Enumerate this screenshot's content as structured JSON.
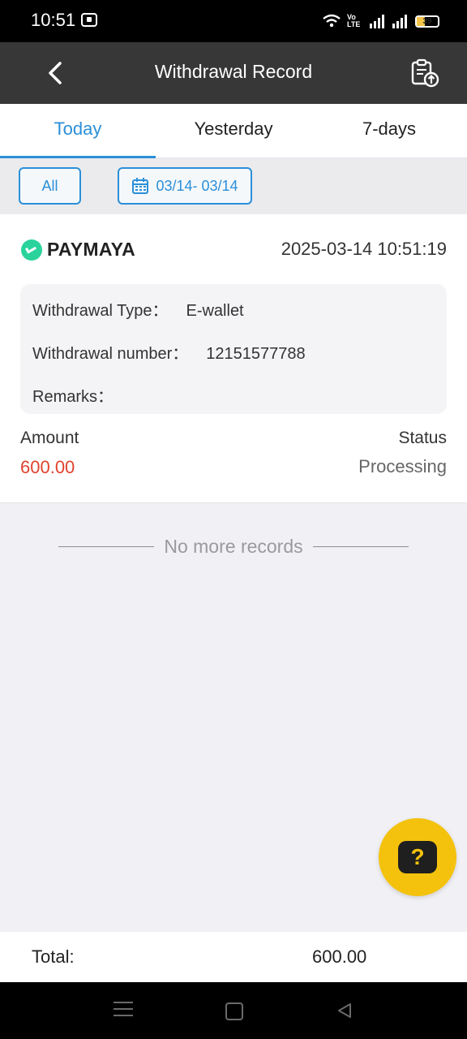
{
  "status_bar": {
    "time": "10:51",
    "network_label": "Vo LTE",
    "battery": "39"
  },
  "header": {
    "title": "Withdrawal Record"
  },
  "tabs": [
    {
      "label": "Today",
      "active": true
    },
    {
      "label": "Yesterday",
      "active": false
    },
    {
      "label": "7-days",
      "active": false
    }
  ],
  "filters": {
    "type_label": "All",
    "date_range": "03/14- 03/14"
  },
  "record": {
    "brand": "PAYMAYA",
    "datetime": "2025-03-14 10:51:19",
    "withdrawal_type_label": "Withdrawal Type：",
    "withdrawal_type_value": "E-wallet",
    "withdrawal_number_label": "Withdrawal number：",
    "withdrawal_number_value": "12151577788",
    "remarks_label": "Remarks：",
    "remarks_value": "",
    "amount_label": "Amount",
    "amount_value": "600.00",
    "status_label": "Status",
    "status_value": "Processing"
  },
  "list_footer": "No more records",
  "help_button": "?",
  "totals": {
    "label": "Total:",
    "value": "600.00"
  },
  "colors": {
    "accent": "#2b8fd8",
    "amount": "#e0432e",
    "header_bg": "#373737",
    "fab": "#f4c20d",
    "brand_logo": "#2ad39b"
  }
}
